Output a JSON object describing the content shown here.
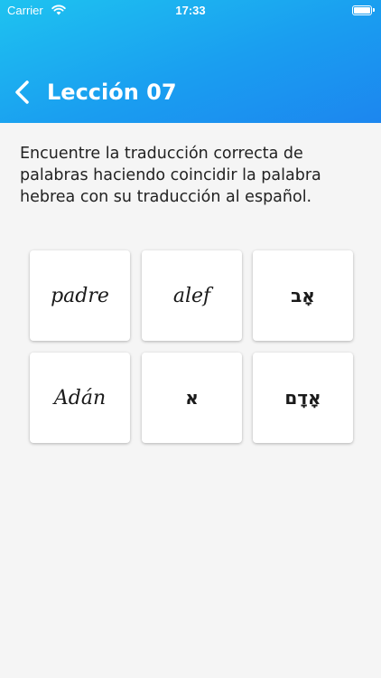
{
  "status_bar": {
    "carrier": "Carrier",
    "time": "17:33",
    "battery_level": 1.0
  },
  "nav": {
    "title": "Lección 07",
    "back_icon": "chevron-left-icon"
  },
  "instructions": "Encuentre la traducción correcta de palabras haciendo coincidir la palabra hebrea con su traducción al español.",
  "cards": [
    {
      "text": "padre",
      "script": "latin"
    },
    {
      "text": "alef",
      "script": "latin"
    },
    {
      "text": "אָב",
      "script": "hebrew"
    },
    {
      "text": "Adán",
      "script": "latin"
    },
    {
      "text": "א",
      "script": "hebrew"
    },
    {
      "text": "אָדָם",
      "script": "hebrew"
    }
  ],
  "colors": {
    "header_gradient_start": "#1ec3f0",
    "header_gradient_end": "#1c86ef",
    "background": "#f5f5f5",
    "card": "#ffffff",
    "text": "#222222"
  }
}
